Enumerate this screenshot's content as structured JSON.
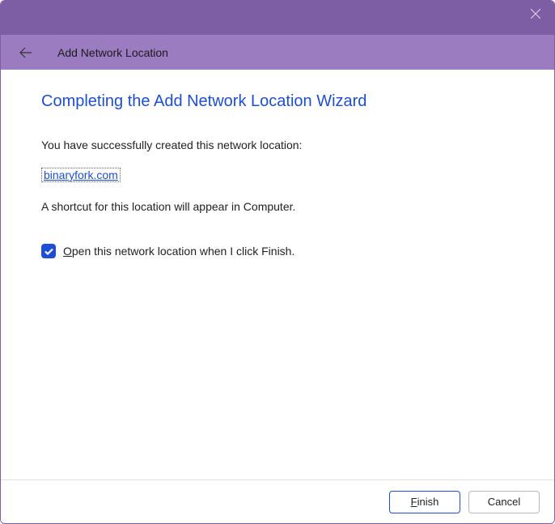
{
  "window": {
    "title": "Add Network Location"
  },
  "content": {
    "heading": "Completing the Add Network Location Wizard",
    "success_text": "You have successfully created this network location:",
    "location_link": "binaryfork.com",
    "shortcut_text": "A shortcut for this location will appear in Computer.",
    "checkbox_label_prefix": "O",
    "checkbox_label_rest": "pen this network location when I click Finish.",
    "checkbox_checked": true
  },
  "footer": {
    "finish_prefix": "F",
    "finish_rest": "inish",
    "cancel_label": "Cancel"
  }
}
